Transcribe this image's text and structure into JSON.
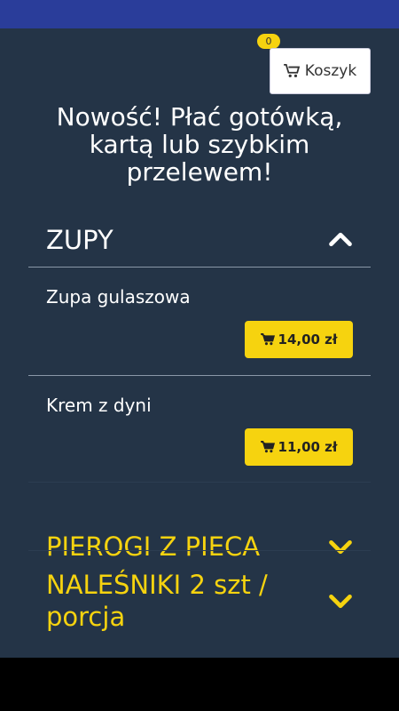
{
  "cart": {
    "label": "Koszyk",
    "count": "0"
  },
  "headline": "Nowość! Płać gotówką, kartą lub szybkim przelewem!",
  "sections": [
    {
      "title": "ZUPY",
      "expanded": true,
      "items": [
        {
          "name": "Zupa gulaszowa",
          "price": "14,00 zł"
        },
        {
          "name": "Krem z dyni",
          "price": "11,00 zł"
        }
      ]
    },
    {
      "title": "PIEROGI Z PIECA",
      "expanded": false
    },
    {
      "title": "NALEŚNIKI 2 szt / porcja",
      "expanded": false
    }
  ],
  "colors": {
    "background": "#243447",
    "accent": "#f6d30f",
    "statusbar": "#2a3d9a"
  },
  "icons": {
    "cart": "cart-icon",
    "expanded": "chevron-up-icon",
    "collapsed": "chevron-down-icon"
  }
}
